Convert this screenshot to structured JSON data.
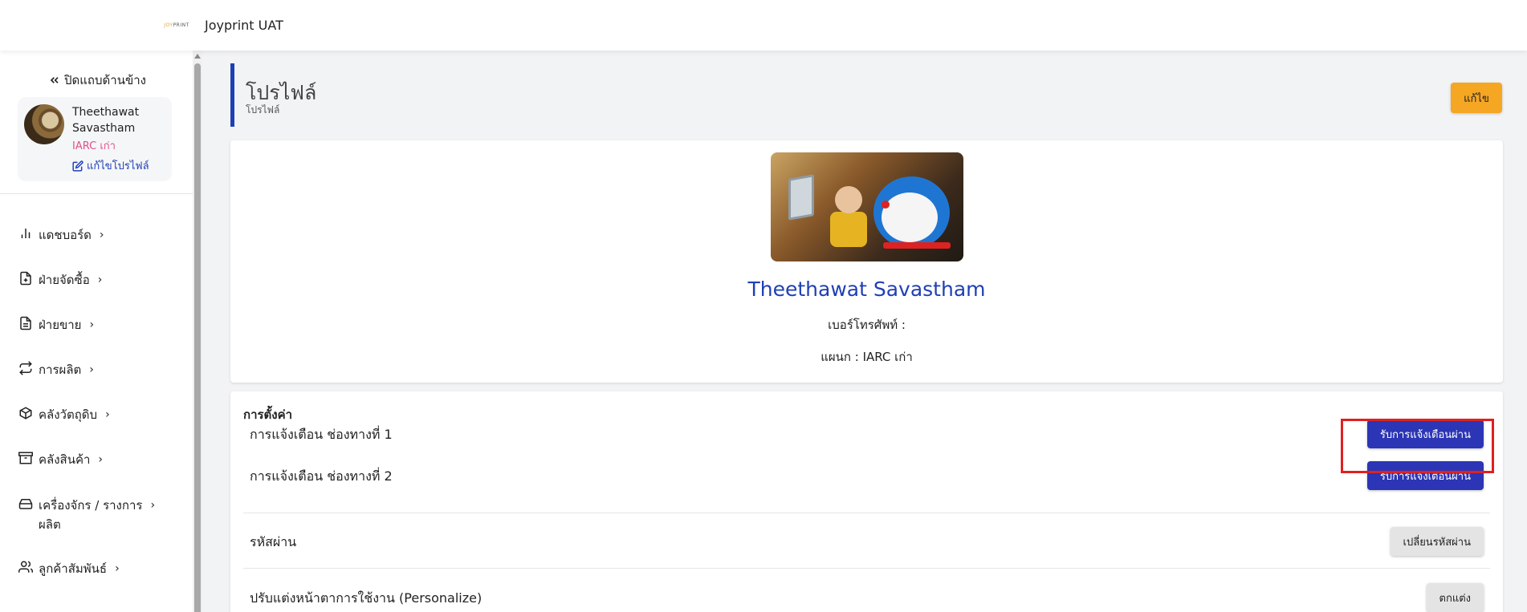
{
  "topbar": {
    "logo_joy": "JOY",
    "logo_print": "PRINT",
    "app_title": "Joyprint UAT"
  },
  "sidebar": {
    "collapse_label": "ปิดแถบด้านข้าง",
    "user": {
      "name": "Theethawat Savastham",
      "department": "IARC เก่า",
      "edit_label": "แก้ไขโปรไฟล์"
    },
    "items": [
      {
        "label": "แดชบอร์ด",
        "icon": "bar-chart-icon"
      },
      {
        "label": "ฝ่ายจัดซื้อ",
        "icon": "file-plus-icon"
      },
      {
        "label": "ฝ่ายขาย",
        "icon": "file-text-icon"
      },
      {
        "label": "การผลิต",
        "icon": "repeat-icon"
      },
      {
        "label": "คลังวัตถุดิบ",
        "icon": "box-icon"
      },
      {
        "label": "คลังสินค้า",
        "icon": "archive-icon"
      },
      {
        "label": "เครื่องจักร / รางการ",
        "label2": "ผลิต",
        "icon": "hard-drive-icon"
      },
      {
        "label": "ลูกค้าสัมพันธ์",
        "icon": "users-icon"
      }
    ]
  },
  "page": {
    "title": "โปรไฟล์",
    "subtitle": "โปรไฟล์",
    "edit_button": "แก้ไข"
  },
  "profile": {
    "name": "Theethawat Savastham",
    "phone_label": "เบอร์โทรศัพท์ :",
    "department_line": "แผนก : IARC เก่า"
  },
  "settings": {
    "title": "การตั้งค่า",
    "rows": [
      {
        "label": "การแจ้งเตือน ช่องทางที่ 1",
        "button": "รับการแจ้งเตือนผ่าน"
      },
      {
        "label": "การแจ้งเตือน ช่องทางที่ 2",
        "button": "รับการแจ้งเตือนผ่าน"
      },
      {
        "label": "รหัสผ่าน",
        "button": "เปลี่ยนรหัสผ่าน"
      },
      {
        "label": "ปรับแต่งหน้าตาการใช้งาน (Personalize)",
        "button": "ตกแต่ง"
      }
    ]
  },
  "colors": {
    "accent": "#1f3fb5",
    "primary_button": "#2b35b5",
    "edit_button": "#f5a623",
    "department_text": "#e0508a",
    "highlight": "#e02020"
  }
}
